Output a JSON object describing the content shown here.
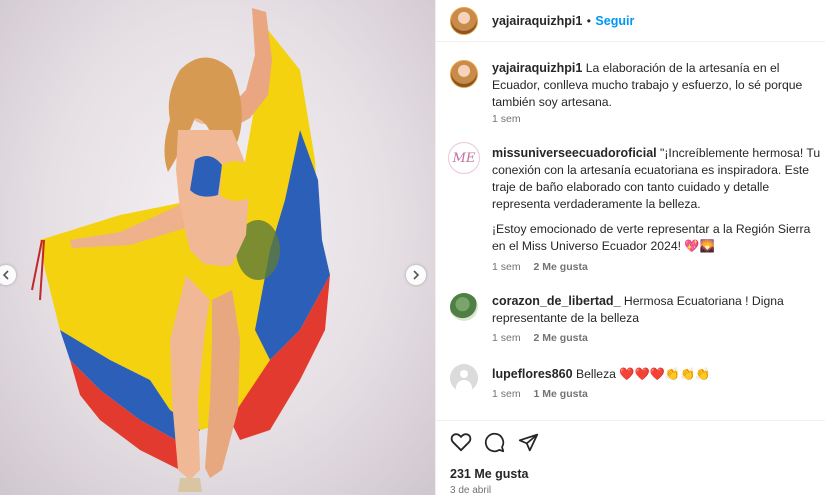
{
  "post": {
    "author": "yajairaquizhpi1",
    "follow_label": "Seguir",
    "dot": "•",
    "caption_user": "yajairaquizhpi1",
    "caption_text": "La elaboración de la artesanía en el Ecuador, conlleva mucho trabajo y esfuerzo, lo sé porque también soy artesana.",
    "caption_time": "1 sem"
  },
  "comments": [
    {
      "user": "missuniverseecuadoroficial",
      "text_p1": "\"¡Increíblemente hermosa! Tu conexión con la artesanía ecuatoriana es inspiradora. Este traje de baño elaborado con tanto cuidado y detalle representa verdaderamente la belleza.",
      "text_p2": "¡Estoy emocionado de verte representar a la Región Sierra en el Miss Universo Ecuador 2024! 💖🌄",
      "time": "1 sem",
      "likes": "2 Me gusta"
    },
    {
      "user": "corazon_de_libertad_",
      "text": "Hermosa Ecuatoriana ! Digna representante de la belleza",
      "time": "1 sem",
      "likes": "2 Me gusta"
    },
    {
      "user": "lupeflores860",
      "text": "Belleza ❤️❤️❤️👏👏👏",
      "time": "1 sem",
      "likes": "1 Me gusta"
    }
  ],
  "footer": {
    "likes_total": "231 Me gusta",
    "date": "3 de abril"
  },
  "icons": {
    "like": "heart-icon",
    "comment": "comment-icon",
    "share": "send-icon",
    "prev": "chevron-left-icon",
    "next": "chevron-right-icon"
  },
  "colors": {
    "accent": "#0095f6",
    "flag_yellow": "#f5d20f",
    "flag_blue": "#2b5fb8",
    "flag_red": "#e23a2e"
  }
}
